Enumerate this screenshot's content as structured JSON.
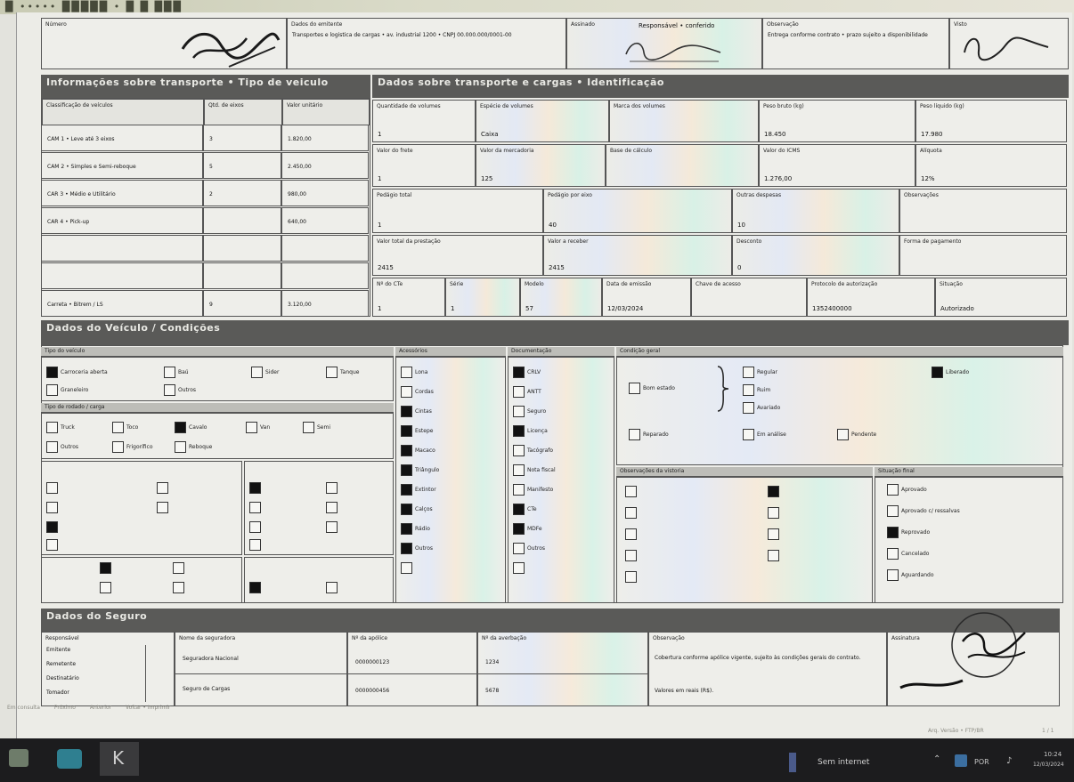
{
  "screen": {
    "top_scroll_text": "█ ••••• █████ • █ █ ███",
    "section1_title": "Informações sobre transporte • Tipo de veiculo",
    "section1_right_title": "Dados sobre transporte e cargas • Identificação",
    "section2_title": "Dados do Veículo / Condições",
    "section3_title": "Dados do Seguro",
    "status_left": [
      "Em consulta",
      "Próximo",
      "Anterior",
      "Voltar • Imprimir"
    ],
    "status_right": "Arq. Versão • FTP/BR",
    "status_page": "1 / 1"
  },
  "top": {
    "cells": [
      {
        "label": "Número",
        "value": ""
      },
      {
        "label": "Dados do emitente",
        "value": "Transportes e logistica de cargas • av. industrial 1200 • CNPJ 00.000.000/0001-00"
      },
      {
        "label": "Assinado",
        "value": "Responsável • conferido"
      },
      {
        "label": "Observação",
        "value": "Entrega conforme contrato • prazo sujeito a disponibilidade"
      },
      {
        "label": "Visto",
        "value": ""
      }
    ]
  },
  "vehicle_table": {
    "headers": [
      "Classificação de veículos",
      "Qtd. de eixos",
      "Valor unitário"
    ],
    "rows": [
      [
        "CAM 1 • Leve até 3 eixos",
        "3",
        "1.820,00"
      ],
      [
        "CAM 2 • Simples e Semi-reboque",
        "5",
        "2.450,00"
      ],
      [
        "CAR 3 • Médio e Utilitário",
        "2",
        "980,00"
      ],
      [
        "CAR 4 • Pick-up",
        "",
        "640,00"
      ],
      [
        "",
        "",
        ""
      ],
      [
        "",
        "",
        ""
      ],
      [
        "Carreta • Bitrem / LS",
        "9",
        "3.120,00"
      ]
    ]
  },
  "grid": {
    "row1": [
      {
        "label": "Quantidade de volumes",
        "value": "1"
      },
      {
        "label": "Espécie de volumes",
        "value": "Caixa"
      },
      {
        "label": "Marca dos volumes",
        "value": ""
      },
      {
        "label": "Peso bruto (kg)",
        "value": "18.450"
      },
      {
        "label": "Peso líquido (kg)",
        "value": "17.980"
      }
    ],
    "row2": [
      {
        "label": "Valor do frete",
        "value": "1"
      },
      {
        "label": "Valor da mercadoria",
        "value": "125"
      },
      {
        "label": "Base de cálculo",
        "value": ""
      },
      {
        "label": "Valor do ICMS",
        "value": "1.276,00"
      },
      {
        "label": "Alíquota",
        "value": "12%"
      }
    ],
    "row3": [
      {
        "label": "Pedágio total",
        "value": "1"
      },
      {
        "label": "Pedágio por eixo",
        "value": "40"
      },
      {
        "label": "Outras despesas",
        "value": "10"
      },
      {
        "label": "Observações",
        "value": ""
      }
    ],
    "row4": [
      {
        "label": "Valor total da prestação",
        "value": "2415"
      },
      {
        "label": "Valor a receber",
        "value": "2415"
      },
      {
        "label": "Desconto",
        "value": "0"
      },
      {
        "label": "Forma de pagamento",
        "value": ""
      }
    ],
    "row5": [
      {
        "label": "Nº do CTe",
        "value": "1"
      },
      {
        "label": "Série",
        "value": "1"
      },
      {
        "label": "Modelo",
        "value": "57"
      },
      {
        "label": "Data de emissão",
        "value": "12/03/2024"
      },
      {
        "label": "Chave de acesso",
        "value": ""
      },
      {
        "label": "Protocolo de autorização",
        "value": "1352400000"
      },
      {
        "label": "Situação",
        "value": "Autorizado"
      }
    ]
  },
  "conditions": {
    "col1_title": "Tipo do veículo",
    "col1_items": [
      {
        "label": "Carroceria aberta",
        "checked": true
      },
      {
        "label": "Baú",
        "checked": false
      },
      {
        "label": "Sider",
        "checked": false
      },
      {
        "label": "Tanque",
        "checked": false
      },
      {
        "label": "Graneleiro",
        "checked": false
      },
      {
        "label": "Outros",
        "checked": false
      }
    ],
    "col1b_title": "Tipo de rodado / carga",
    "col1b_items": [
      {
        "label": "Truck",
        "checked": false
      },
      {
        "label": "Toco",
        "checked": false
      },
      {
        "label": "Cavalo",
        "checked": true
      },
      {
        "label": "Van",
        "checked": false
      },
      {
        "label": "Outros",
        "checked": false
      },
      {
        "label": "Frigorífico",
        "checked": false
      },
      {
        "label": "Reboque",
        "checked": false
      },
      {
        "label": "Semi",
        "checked": false
      }
    ],
    "col2_title": "Acessórios",
    "col2_items": [
      {
        "label": "Lona",
        "checked": false
      },
      {
        "label": "Cordas",
        "checked": false
      },
      {
        "label": "Cintas",
        "checked": true
      },
      {
        "label": "Estepe",
        "checked": true
      },
      {
        "label": "Macaco",
        "checked": true
      },
      {
        "label": "Triângulo",
        "checked": true
      },
      {
        "label": "Extintor",
        "checked": true
      },
      {
        "label": "Calços",
        "checked": true
      },
      {
        "label": "Rádio",
        "checked": true
      },
      {
        "label": "Outros",
        "checked": true
      },
      {
        "label": "",
        "checked": false
      }
    ],
    "col3_title": "Documentação",
    "col3_items": [
      {
        "label": "CRLV",
        "checked": true
      },
      {
        "label": "ANTT",
        "checked": false
      },
      {
        "label": "Seguro",
        "checked": false
      },
      {
        "label": "Licença",
        "checked": true
      },
      {
        "label": "Tacógrafo",
        "checked": false
      },
      {
        "label": "Nota fiscal",
        "checked": false
      },
      {
        "label": "Manifesto",
        "checked": false
      },
      {
        "label": "CTe",
        "checked": true
      },
      {
        "label": "MDFe",
        "checked": true
      },
      {
        "label": "Outros",
        "checked": false
      },
      {
        "label": "",
        "checked": false
      }
    ],
    "col4_title": "Condição geral",
    "col4_items": [
      {
        "label": "Bom estado",
        "checked": false
      },
      {
        "label": "Regular",
        "checked": false
      },
      {
        "label": "Ruim",
        "checked": false
      },
      {
        "label": "Avariado",
        "checked": false
      },
      {
        "label": "Reparado",
        "checked": false
      },
      {
        "label": "Em análise",
        "checked": false
      },
      {
        "label": "Pendente",
        "checked": false
      },
      {
        "label": "Liberado",
        "checked": true
      }
    ],
    "col5_title": "Observações da vistoria",
    "col6_title": "Situação final",
    "col6_items": [
      {
        "label": "Aprovado",
        "checked": false
      },
      {
        "label": "Aprovado c/ ressalvas",
        "checked": false
      },
      {
        "label": "Reprovado",
        "checked": true
      },
      {
        "label": "Cancelado",
        "checked": false
      },
      {
        "label": "Aguardando",
        "checked": false
      }
    ]
  },
  "insurance": {
    "headers": [
      "Responsável",
      "Nome da seguradora",
      "Nº da apólice",
      "Nº da averbação",
      "Observação",
      "Assinatura"
    ],
    "left_items": [
      "Emitente",
      "Remetente",
      "Destinatário",
      "Tomador"
    ],
    "name1": "Seguradora Nacional",
    "name2": "Seguro de Cargas",
    "policy1": "0000000123",
    "policy2": "0000000456",
    "av1": "1234",
    "av2": "5678",
    "obs": "Cobertura conforme apólice vigente, sujeito às condições gerais do contrato.",
    "obs2": "Valores em reais (R$)."
  },
  "taskbar": {
    "app_label": "Sem internet",
    "lang": "POR",
    "time": "10:24",
    "date": "12/03/2024"
  },
  "colors": {
    "form_bg": "#eeeeea",
    "header_bg": "#5a5a58",
    "taskbar_bg": "#1c1c1e",
    "desktop_bg": "#e3e3dd"
  }
}
